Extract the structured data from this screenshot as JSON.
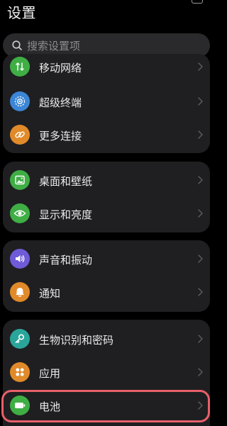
{
  "header": {
    "title": "设置"
  },
  "search": {
    "placeholder": "搜索设置项",
    "icon": "search-icon"
  },
  "groups": [
    {
      "items": [
        {
          "label": "移动网络",
          "icon": "mobile-network-icon",
          "icon_color": "#3fae45"
        },
        {
          "label": "超级终端",
          "icon": "super-device-icon",
          "icon_color": "#3b86d6"
        },
        {
          "label": "更多连接",
          "icon": "link-icon",
          "icon_color": "#e08a2a"
        }
      ]
    },
    {
      "items": [
        {
          "label": "桌面和壁纸",
          "icon": "wallpaper-icon",
          "icon_color": "#3fae45"
        },
        {
          "label": "显示和亮度",
          "icon": "eye-icon",
          "icon_color": "#3fae45"
        }
      ]
    },
    {
      "items": [
        {
          "label": "声音和振动",
          "icon": "speaker-icon",
          "icon_color": "#6f5ad8"
        },
        {
          "label": "通知",
          "icon": "bell-icon",
          "icon_color": "#e08a2a"
        }
      ]
    },
    {
      "items": [
        {
          "label": "生物识别和密码",
          "icon": "key-icon",
          "icon_color": "#2aa59a"
        },
        {
          "label": "应用",
          "icon": "apps-icon",
          "icon_color": "#e08a2a"
        },
        {
          "label": "电池",
          "icon": "battery-icon",
          "icon_color": "#3fae45"
        }
      ]
    }
  ],
  "highlighted_item": "电池",
  "colors": {
    "background": "#000000",
    "card": "#1f1f21",
    "highlight_border": "#e8606a",
    "chevron": "#5a5a5c"
  }
}
